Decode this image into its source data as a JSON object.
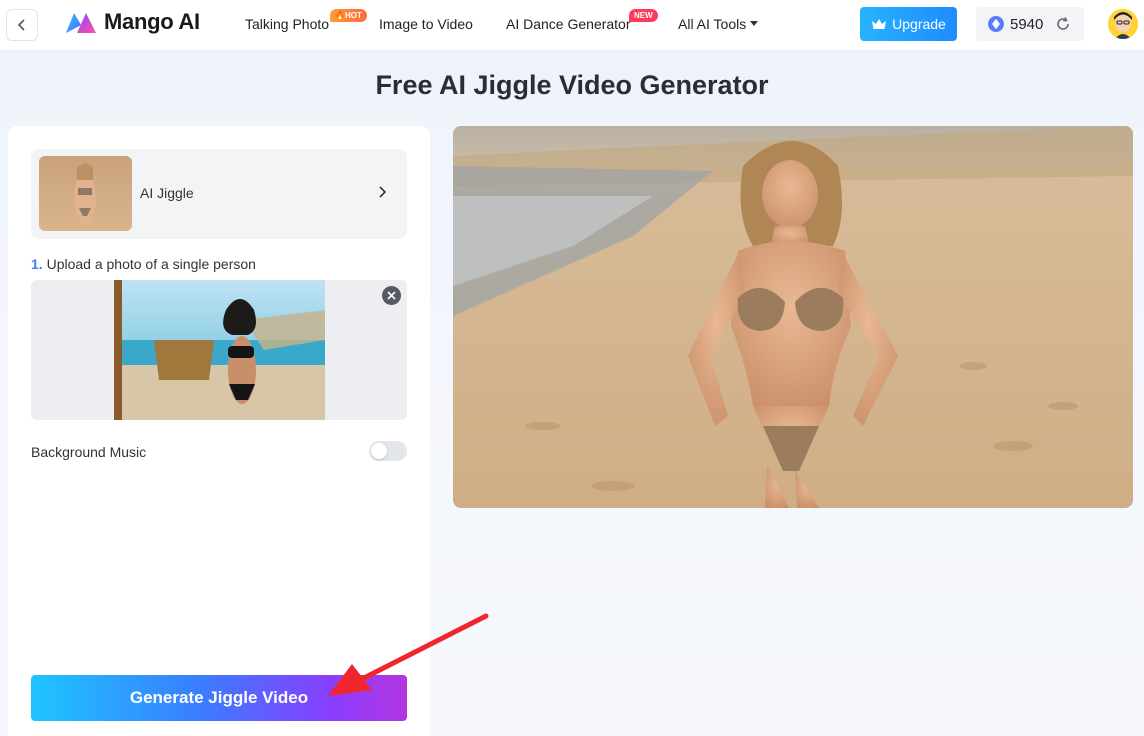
{
  "nav": {
    "brand": "Mango AI",
    "items": [
      {
        "label": "Talking Photo",
        "badge": "HOT"
      },
      {
        "label": "Image to Video",
        "badge": ""
      },
      {
        "label": "AI Dance Generator",
        "badge": "NEW"
      },
      {
        "label": "All AI Tools",
        "badge": ""
      }
    ],
    "upgrade_label": "Upgrade",
    "credits": "5940"
  },
  "page": {
    "title": "Free AI Jiggle Video Generator"
  },
  "left_panel": {
    "effect_label": "AI Jiggle",
    "step_number": "1.",
    "step_text": "Upload a photo of a single person",
    "music_label": "Background Music",
    "music_enabled": false,
    "generate_label": "Generate Jiggle Video"
  },
  "colors": {
    "upgrade": "#1f8bff",
    "step_number": "#3a7bff",
    "hot_badge": "#ff6a3c",
    "new_badge": "#ff3b5c",
    "annotation_arrow": "#f0262d"
  },
  "icons": {
    "back": "chevron-left-icon",
    "upgrade": "crown-icon",
    "credits": "gem-icon",
    "refresh": "refresh-icon",
    "effect": "chevron-right-icon",
    "remove": "close-icon",
    "dropdown": "caret-down-icon"
  }
}
